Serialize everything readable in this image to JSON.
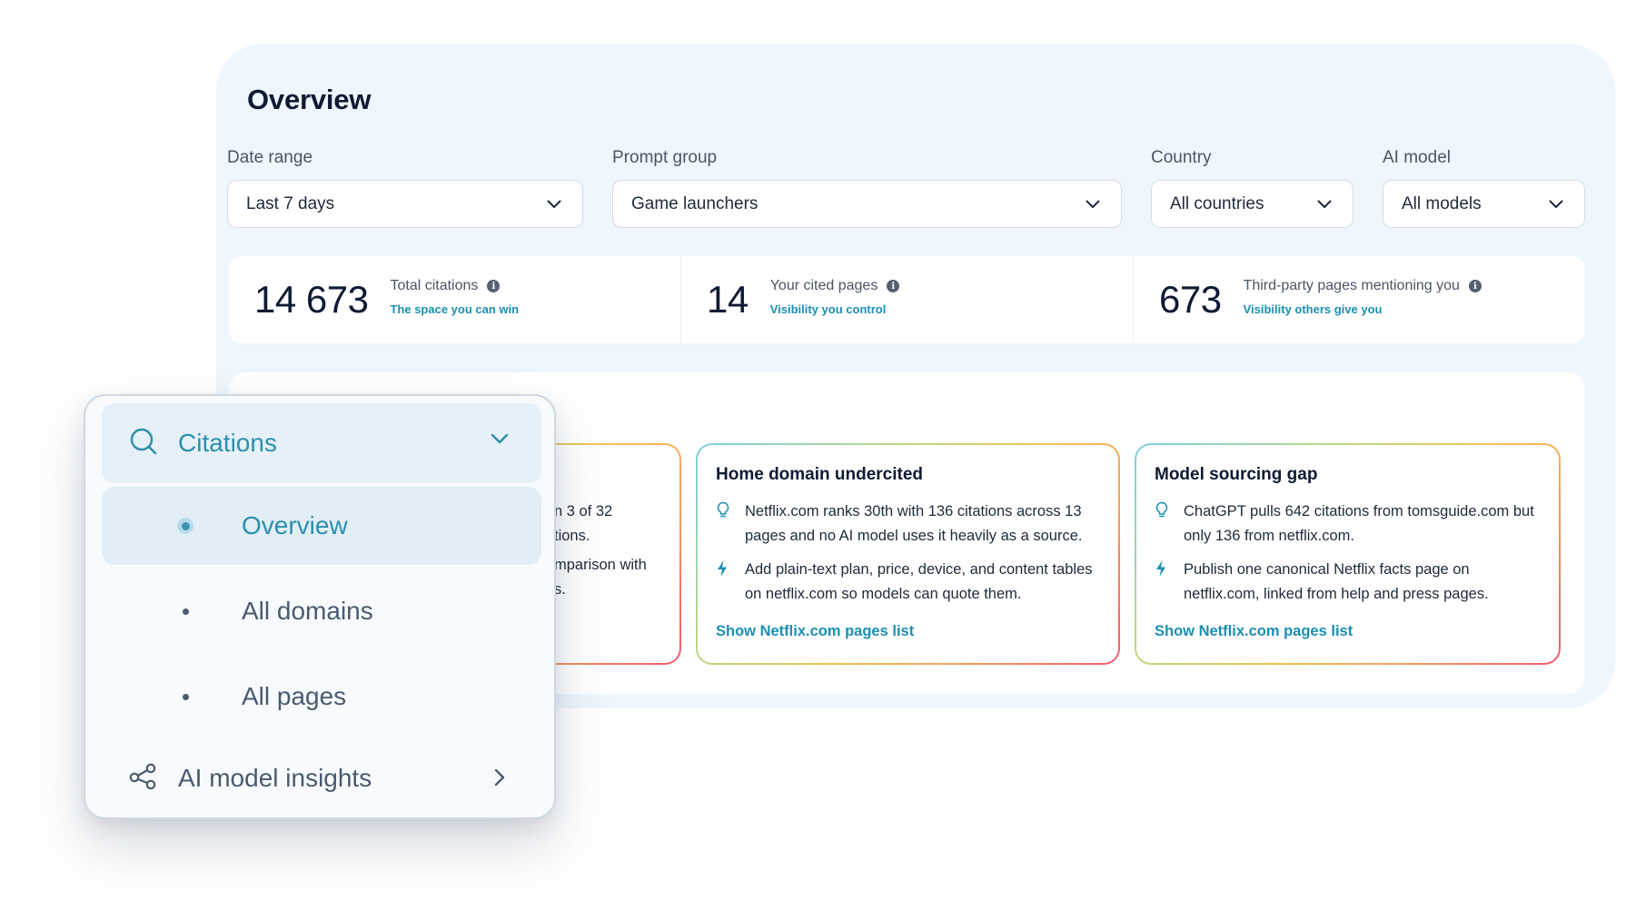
{
  "page": {
    "title": "Overview"
  },
  "filters": {
    "date_range": {
      "label": "Date range",
      "value": "Last 7 days"
    },
    "prompt_group": {
      "label": "Prompt group",
      "value": "Game launchers"
    },
    "country": {
      "label": "Country",
      "value": "All countries"
    },
    "ai_model": {
      "label": "AI model",
      "value": "All models"
    }
  },
  "stats": [
    {
      "value": "14 673",
      "title": "Total citations",
      "subtitle": "The space you can win"
    },
    {
      "value": "14",
      "title": "Your cited pages",
      "subtitle": "Visibility you control"
    },
    {
      "value": "673",
      "title": "Third-party pages mentioning you",
      "subtitle": "Visibility others give you"
    }
  ],
  "cards": [
    {
      "partial_lines": [
        "n 3 of 32",
        "tions.",
        "mparison with",
        "s."
      ]
    },
    {
      "title": "Home domain undercited",
      "insight": "Netflix.com ranks 30th with 136 citations across 13 pages and no AI model uses it heavily as a source.",
      "action": "Add plain-text plan, price, device, and content tables on netflix.com so models can quote them.",
      "link": "Show Netflix.com pages list"
    },
    {
      "title": "Model sourcing gap",
      "insight": "ChatGPT pulls 642 citations from tomsguide.com but only 136 from netflix.com.",
      "action": "Publish one canonical Netflix facts page on netflix.com, linked from help and press pages.",
      "link": "Show Netflix.com pages list"
    }
  ],
  "nav": {
    "section": {
      "label": "Citations",
      "icon": "search-icon"
    },
    "items": [
      {
        "label": "Overview",
        "active": true
      },
      {
        "label": "All domains",
        "active": false
      },
      {
        "label": "All pages",
        "active": false
      }
    ],
    "footer": {
      "label": "AI model insights",
      "icon": "share-nodes-icon"
    }
  },
  "colors": {
    "accent": "#1b8fb3",
    "nav_accent": "#2a8fae",
    "panel_bg": "#eff6fd"
  }
}
